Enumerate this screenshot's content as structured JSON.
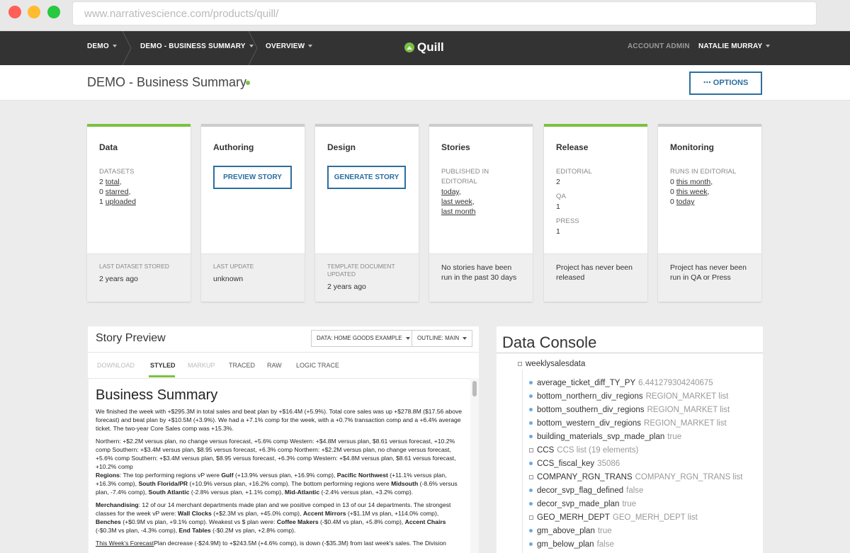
{
  "browser": {
    "url": "www.narrativescience.com/products/quill/"
  },
  "nav": {
    "items": [
      "DEMO",
      "DEMO - BUSINESS SUMMARY",
      "OVERVIEW"
    ],
    "logo": "Quill",
    "account_admin": "ACCOUNT ADMIN",
    "user": "NATALIE MURRAY"
  },
  "page": {
    "title": "DEMO - Business Summary",
    "options_label": "⋯ OPTIONS"
  },
  "cards": {
    "data": {
      "title": "Data",
      "label": "DATASETS",
      "lines": [
        {
          "num": "2",
          "link": "total",
          "suffix": ","
        },
        {
          "num": "0",
          "link": "starred",
          "suffix": ","
        },
        {
          "num": "1",
          "link": "uploaded",
          "suffix": ""
        }
      ],
      "foot_label": "LAST DATASET STORED",
      "foot_value": "2 years ago"
    },
    "authoring": {
      "title": "Authoring",
      "button": "PREVIEW STORY",
      "foot_label": "LAST UPDATE",
      "foot_value": "unknown"
    },
    "design": {
      "title": "Design",
      "button": "GENERATE STORY",
      "foot_label": "TEMPLATE DOCUMENT UPDATED",
      "foot_value": "2 years ago"
    },
    "stories": {
      "title": "Stories",
      "label": "PUBLISHED IN EDITORIAL",
      "links": [
        "today",
        "last week",
        "last month"
      ],
      "foot_value": "No stories have been run in the past 30 days"
    },
    "release": {
      "title": "Release",
      "groups": [
        {
          "label": "EDITORIAL",
          "value": "2"
        },
        {
          "label": "QA",
          "value": "1"
        },
        {
          "label": "PRESS",
          "value": "1"
        }
      ],
      "foot_value": "Project has never been released"
    },
    "monitoring": {
      "title": "Monitoring",
      "label": "RUNS IN EDITORIAL",
      "lines": [
        {
          "num": "0",
          "link": "this month",
          "suffix": ","
        },
        {
          "num": "0",
          "link": "this week",
          "suffix": ","
        },
        {
          "num": "0",
          "link": "today",
          "suffix": ""
        }
      ],
      "foot_value": "Project has never been run in QA or Press"
    }
  },
  "story": {
    "heading": "Story Preview",
    "data_dropdown": "DATA:  HOME GOODS EXAMPLE",
    "outline_dropdown": "OUTLINE:  MAIN",
    "tabs": [
      "DOWNLOAD",
      "STYLED",
      "MARKUP",
      "TRACED",
      "RAW",
      "LOGIC TRACE"
    ],
    "doc_title": "Business Summary",
    "p1": "We finished the week with +$295.3M in total sales and beat plan by +$16.4M (+5.9%). Total core sales was up +$278.8M ($17.56 above forecast) and beat plan by +$10.5M (+3.9%). We had a +7.1% comp for the week, with a +0.7% transaction comp and a +6.4% average ticket. The two-year Core Sales comp was +15.3%.",
    "p2": "Northern: +$2.2M versus plan, no change versus forecast, +5.6% comp Western: +$4.8M versus plan, $8.61 versus forecast, +10.2% comp Southern: +$3.4M versus plan, $8.95 versus forecast, +6.3% comp Northern: +$2.2M versus plan, no change versus forecast, +5.6% comp Southern: +$3.4M versus plan, $8.95 versus forecast, +6.3% comp Western: +$4.8M versus plan, $8.61 versus forecast, +10.2% comp",
    "p3": {
      "lead": "Regions",
      "a": ": The top performing regions vP were ",
      "gulf": "Gulf",
      "b": " (+13.9% versus plan, +16.9% comp), ",
      "pnw": "Pacific Northwest",
      "c": " (+11.1% versus plan, +16.3% comp), ",
      "sfl": "South Florida/PR",
      "d": " (+10.9% versus plan, +16.2% comp). The bottom performing regions were ",
      "mid": "Midsouth",
      "e": " (-8.6% versus plan, -7.4% comp), ",
      "sat": "South Atlantic",
      "f": " (-2.8% versus plan, +1.1% comp), ",
      "mat": "Mid-Atlantic",
      "g": " (-2.4% versus plan, +3.2% comp)."
    },
    "p4": {
      "lead": "Merchandising",
      "a": ": 12 of our 14 merchant departments made plan and we positive comped in 13 of our 14 departments. The strongest classes for the week vP were: ",
      "wc": "Wall Clocks",
      "b": " (+$2.3M vs plan, +45.0% comp), ",
      "am": "Accent Mirrors",
      "c": " (+$1.1M vs plan, +114.0% comp), ",
      "be": "Benches",
      "d": " (+$0.9M vs plan, +9.1% comp). Weakest vs $ plan were: ",
      "cm": "Coffee Makers",
      "e": " (-$0.4M vs plan, +5.8% comp), ",
      "ac": "Accent Chairs",
      "f": " (-$0.3M vs plan, -4.3% comp), ",
      "et": "End Tables",
      "g": " (-$0.2M vs plan, +2.8% comp)."
    },
    "p5": {
      "link": "This Week's Forecast",
      "text": "Plan decrease (-$24.9M) to +$243.5M (+4.6% comp), is down (-$35.3M) from last week's sales. The Division"
    }
  },
  "console": {
    "heading": "Data Console",
    "root": "weeklysalesdata",
    "items": [
      {
        "key": "average_ticket_diff_TY_PY",
        "value": "6.441279304240675",
        "marker": "dot"
      },
      {
        "key": "bottom_northern_div_regions",
        "value": "REGION_MARKET list",
        "marker": "dot"
      },
      {
        "key": "bottom_southern_div_regions",
        "value": "REGION_MARKET list",
        "marker": "dot"
      },
      {
        "key": "bottom_western_div_regions",
        "value": "REGION_MARKET list",
        "marker": "dot"
      },
      {
        "key": "building_materials_svp_made_plan",
        "value": "true",
        "marker": "dot"
      },
      {
        "key": "CCS",
        "value": "CCS list (19 elements)",
        "marker": "square"
      },
      {
        "key": "CCS_fiscal_key",
        "value": "35086",
        "marker": "dot"
      },
      {
        "key": "COMPANY_RGN_TRANS",
        "value": "COMPANY_RGN_TRANS list",
        "marker": "square"
      },
      {
        "key": "decor_svp_flag_defined",
        "value": "false",
        "marker": "dot"
      },
      {
        "key": "decor_svp_made_plan",
        "value": "true",
        "marker": "dot"
      },
      {
        "key": "GEO_MERH_DEPT",
        "value": "GEO_MERH_DEPT list",
        "marker": "square"
      },
      {
        "key": "gm_above_plan",
        "value": "true",
        "marker": "dot"
      },
      {
        "key": "gm_below_plan",
        "value": "false",
        "marker": "dot"
      }
    ]
  }
}
